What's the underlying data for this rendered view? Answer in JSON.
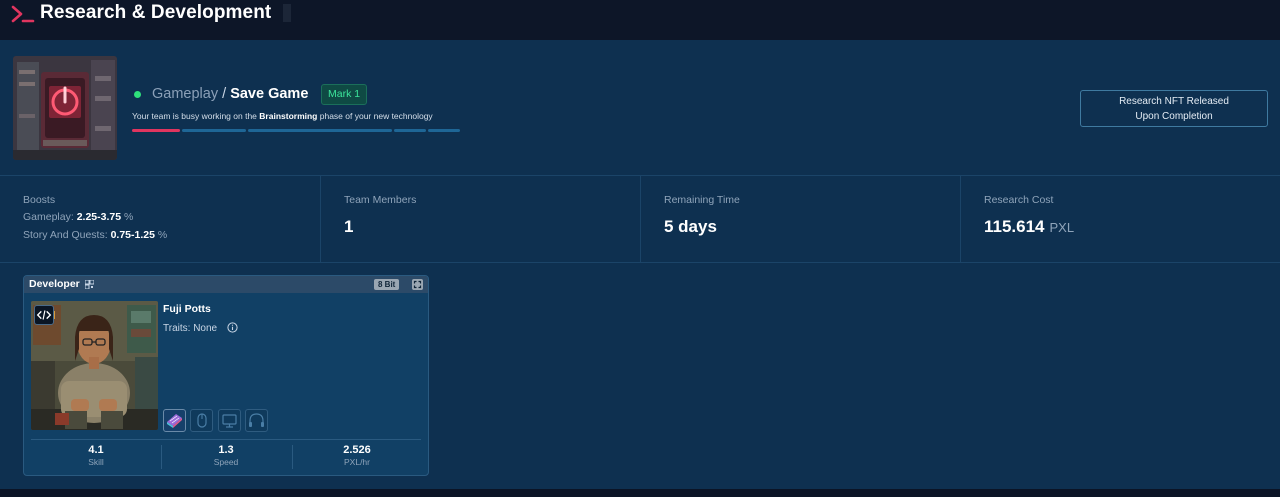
{
  "header": {
    "title": "Research & Development"
  },
  "project": {
    "category": "Gameplay",
    "separator": "/",
    "name": "Save Game",
    "mark": "Mark 1",
    "description_prefix": "Your team is busy working on the",
    "phase": "Brainstorming",
    "description_suffix": "phase of your new technology",
    "progress_segments": [
      "active",
      "pending",
      "pending",
      "pending",
      "pending",
      "pending"
    ],
    "status_color": "#2ee07c",
    "active_color": "#e0355f",
    "nft_button_line1": "Research NFT Released",
    "nft_button_line2": "Upon Completion"
  },
  "stats": {
    "boosts": {
      "label": "Boosts",
      "lines": [
        {
          "name": "Gameplay:",
          "value": "2.25-3.75",
          "unit": "%"
        },
        {
          "name": "Story And Quests:",
          "value": "0.75-1.25",
          "unit": "%"
        }
      ]
    },
    "team_members": {
      "label": "Team Members",
      "value": "1"
    },
    "remaining_time": {
      "label": "Remaining Time",
      "value": "5 days"
    },
    "research_cost": {
      "label": "Research Cost",
      "value": "115.614",
      "unit": "PXL"
    }
  },
  "developer_card": {
    "role": "Developer",
    "bits": "8 Bit",
    "name": "Fuji Potts",
    "traits_label": "Traits:",
    "traits_value": "None",
    "equipment_slots": [
      "keyboard-icon",
      "mouse-icon",
      "monitor-icon",
      "headphones-icon"
    ],
    "metrics": [
      {
        "value": "4.1",
        "label": "Skill"
      },
      {
        "value": "1.3",
        "label": "Speed"
      },
      {
        "value": "2.526",
        "label": "PXL/hr"
      }
    ]
  }
}
